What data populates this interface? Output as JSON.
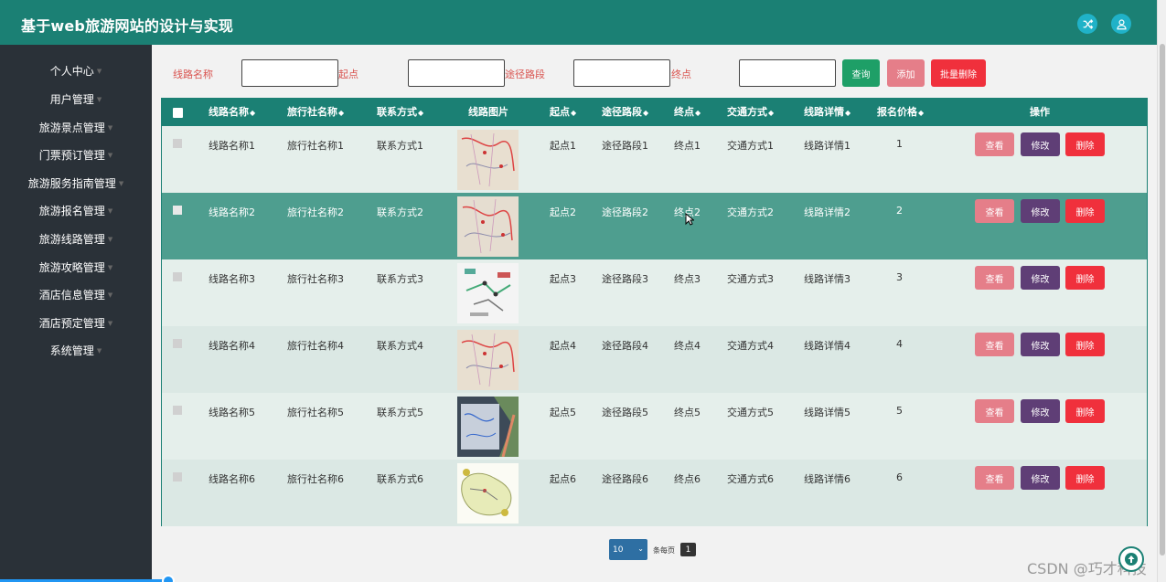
{
  "header": {
    "title": "基于web旅游网站的设计与实现",
    "icons": [
      "shuffle-icon",
      "user-icon"
    ]
  },
  "sidebar": {
    "items": [
      {
        "label": "个人中心"
      },
      {
        "label": "用户管理"
      },
      {
        "label": "旅游景点管理"
      },
      {
        "label": "门票预订管理"
      },
      {
        "label": "旅游服务指南管理"
      },
      {
        "label": "旅游报名管理"
      },
      {
        "label": "旅游线路管理"
      },
      {
        "label": "旅游攻略管理"
      },
      {
        "label": "酒店信息管理"
      },
      {
        "label": "酒店预定管理"
      },
      {
        "label": "系统管理"
      }
    ]
  },
  "search": {
    "labels": [
      "线路名称",
      "起点",
      "途径路段",
      "终点"
    ],
    "values": [
      "",
      "",
      "",
      ""
    ],
    "query_label": "查询",
    "add_label": "添加",
    "batch_delete_label": "批量删除"
  },
  "table": {
    "headers": [
      "线路名称",
      "旅行社名称",
      "联系方式",
      "线路图片",
      "起点",
      "途径路段",
      "终点",
      "交通方式",
      "线路详情",
      "报名价格",
      "操作"
    ],
    "sort_icon": "◆",
    "rows": [
      {
        "name": "线路名称1",
        "agency": "旅行社名称1",
        "contact": "联系方式1",
        "start": "起点1",
        "via": "途径路段1",
        "end": "终点1",
        "transport": "交通方式1",
        "detail": "线路详情1",
        "price": "1"
      },
      {
        "name": "线路名称2",
        "agency": "旅行社名称2",
        "contact": "联系方式2",
        "start": "起点2",
        "via": "途径路段2",
        "end": "终点2",
        "transport": "交通方式2",
        "detail": "线路详情2",
        "price": "2"
      },
      {
        "name": "线路名称3",
        "agency": "旅行社名称3",
        "contact": "联系方式3",
        "start": "起点3",
        "via": "途径路段3",
        "end": "终点3",
        "transport": "交通方式3",
        "detail": "线路详情3",
        "price": "3"
      },
      {
        "name": "线路名称4",
        "agency": "旅行社名称4",
        "contact": "联系方式4",
        "start": "起点4",
        "via": "途径路段4",
        "end": "终点4",
        "transport": "交通方式4",
        "detail": "线路详情4",
        "price": "4"
      },
      {
        "name": "线路名称5",
        "agency": "旅行社名称5",
        "contact": "联系方式5",
        "start": "起点5",
        "via": "途径路段5",
        "end": "终点5",
        "transport": "交通方式5",
        "detail": "线路详情5",
        "price": "5"
      },
      {
        "name": "线路名称6",
        "agency": "旅行社名称6",
        "contact": "联系方式6",
        "start": "起点6",
        "via": "途径路段6",
        "end": "终点6",
        "transport": "交通方式6",
        "detail": "线路详情6",
        "price": "6"
      }
    ],
    "actions": {
      "view": "查看",
      "edit": "修改",
      "delete": "删除"
    }
  },
  "pager": {
    "page_size": "10",
    "per_page_label": "条每页",
    "current_page": "1"
  },
  "watermark": "CSDN @巧才科技",
  "colors": {
    "header": "#1b8074",
    "sidebar": "#2a3138",
    "view": "#e57e89",
    "edit": "#5f3e76",
    "delete": "#f0303c",
    "query": "#1e9f67"
  }
}
